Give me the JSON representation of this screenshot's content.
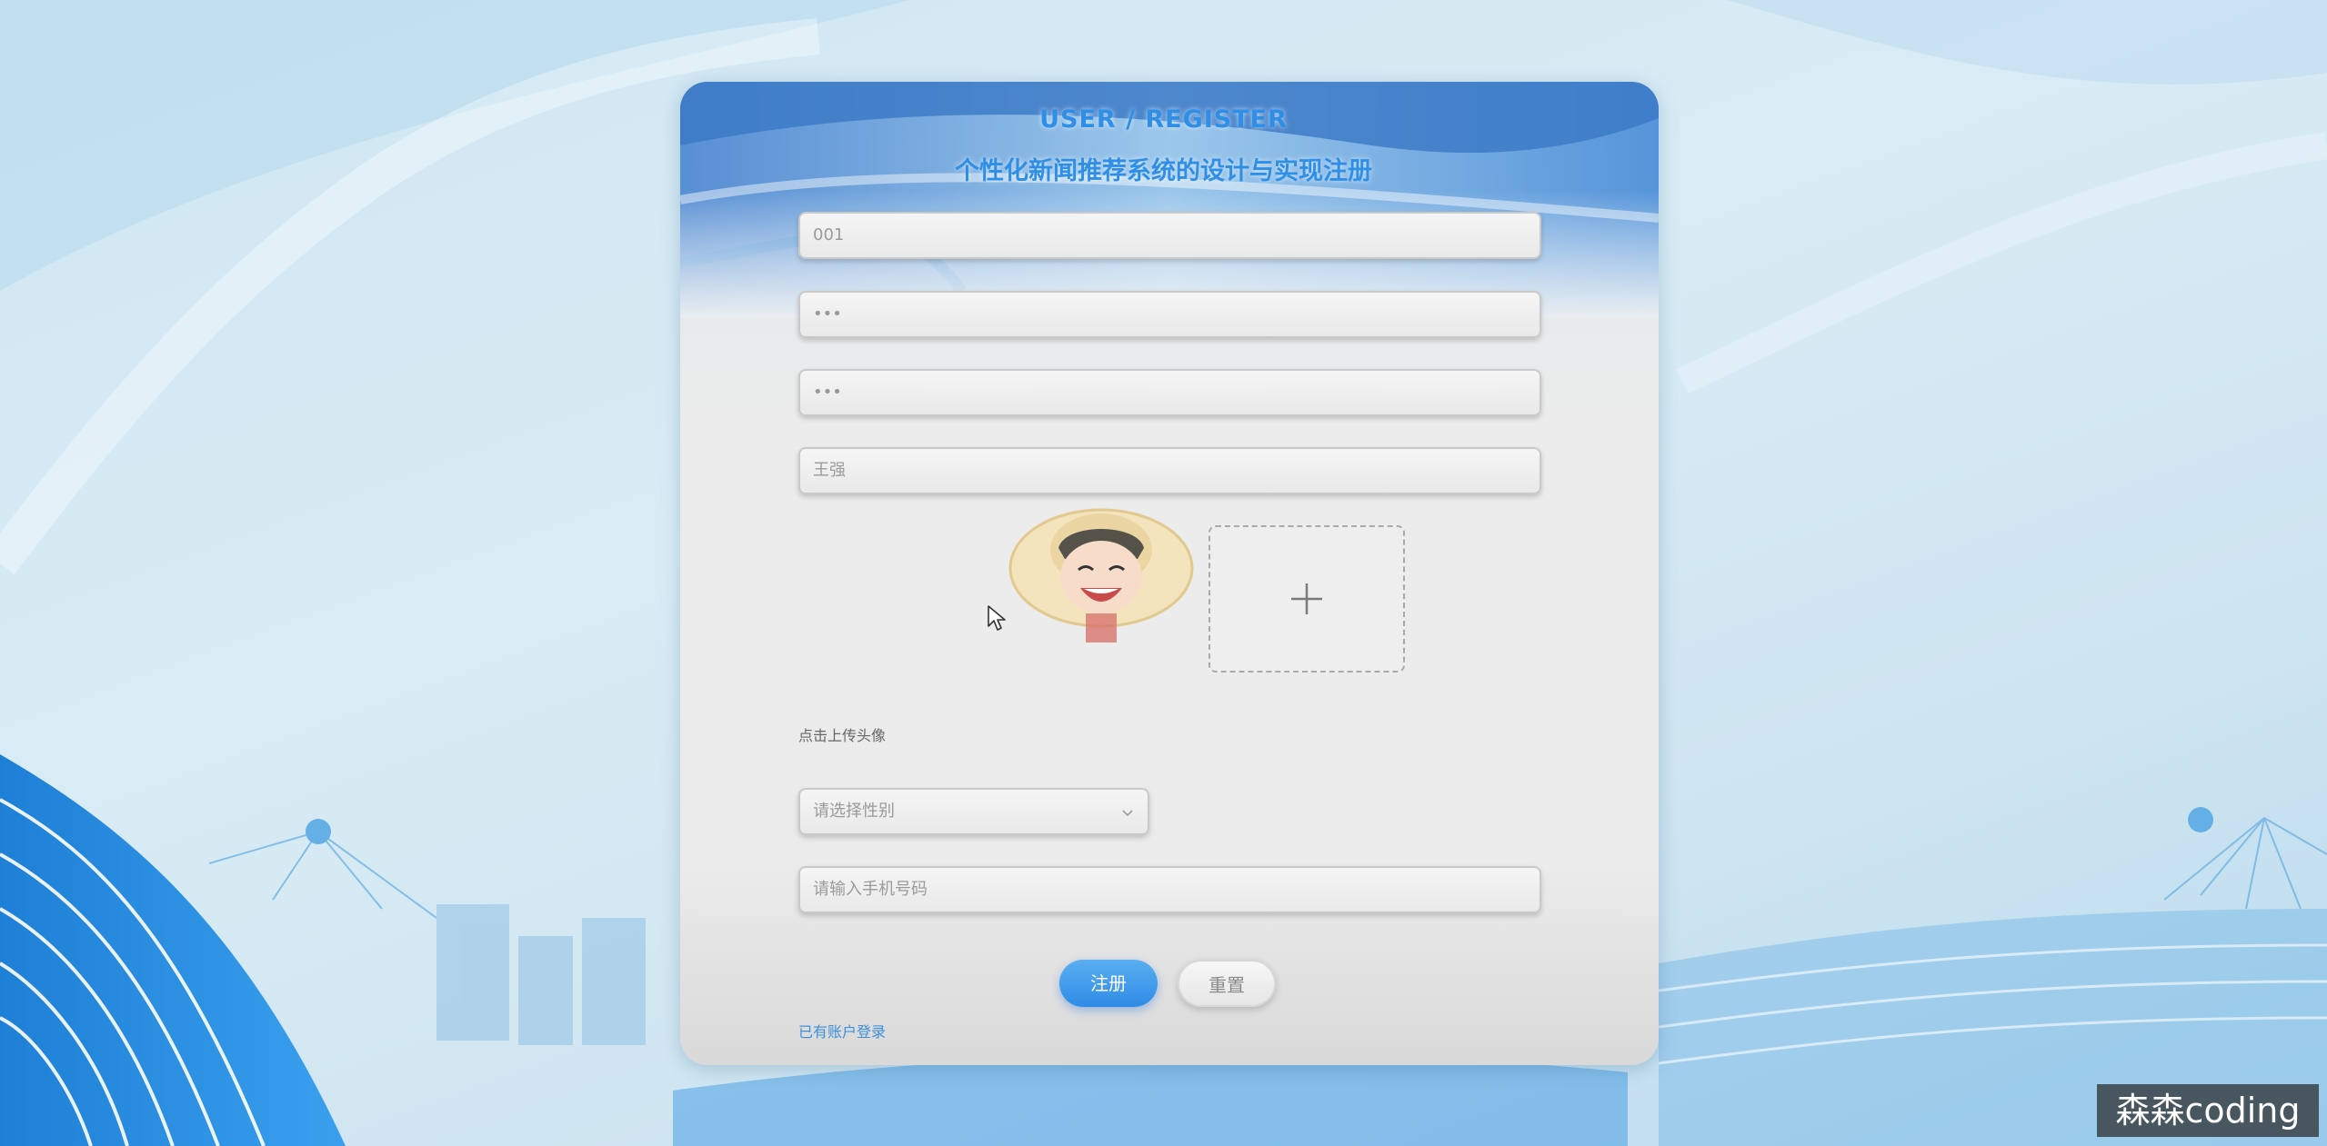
{
  "header": {
    "title_en": "USER / REGISTER",
    "title_cn": "个性化新闻推荐系统的设计与实现注册"
  },
  "form": {
    "account": {
      "value": "001"
    },
    "password": {
      "value": "•••"
    },
    "confirm_password": {
      "value": "•••"
    },
    "name": {
      "value": "王强"
    },
    "avatar": {
      "upload_label": "点击上传头像",
      "icon": "plus-icon"
    },
    "gender": {
      "placeholder": "请选择性别",
      "icon": "chevron-down-icon"
    },
    "phone": {
      "placeholder": "请输入手机号码"
    }
  },
  "actions": {
    "register_label": "注册",
    "reset_label": "重置",
    "login_link": "已有账户登录"
  },
  "watermark": "森森coding",
  "colors": {
    "accent": "#2f8fe6",
    "primary_button": "#3b92e8",
    "link": "#3d8fd8"
  }
}
